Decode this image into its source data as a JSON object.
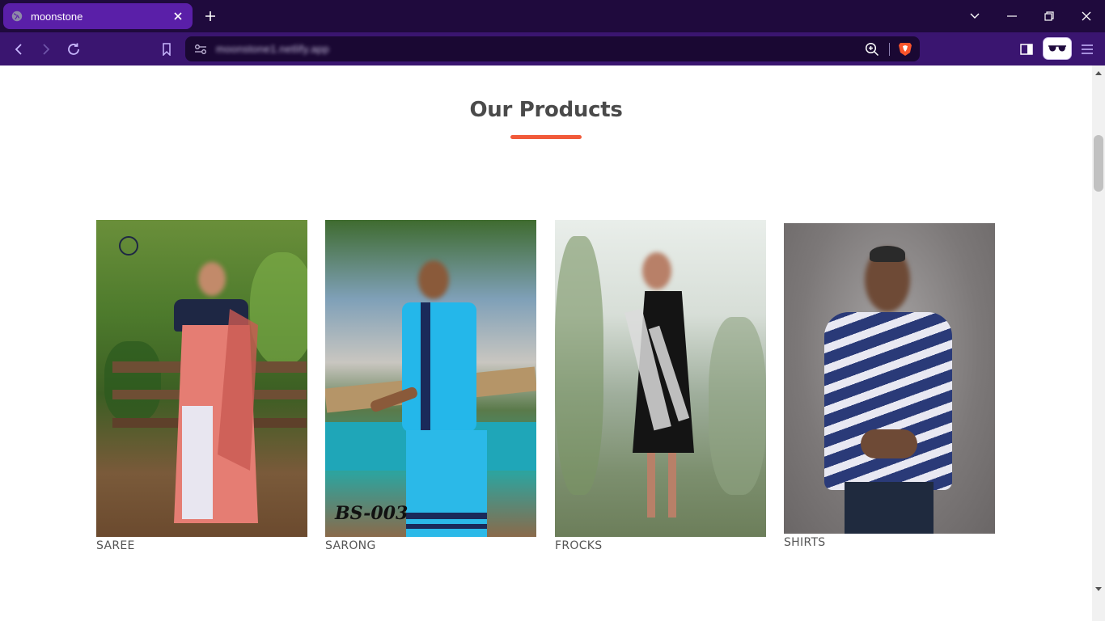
{
  "browser": {
    "tab_title": "moonstone",
    "url": "moonstone1.netlify.app",
    "accent": "#5a1fa8"
  },
  "section": {
    "title": "Our Products",
    "underline_color": "#f15a3a"
  },
  "products": [
    {
      "label": "SAREE"
    },
    {
      "label": "SARONG",
      "photo_caption": "BS-003"
    },
    {
      "label": "FROCKS"
    },
    {
      "label": "SHIRTS"
    }
  ]
}
